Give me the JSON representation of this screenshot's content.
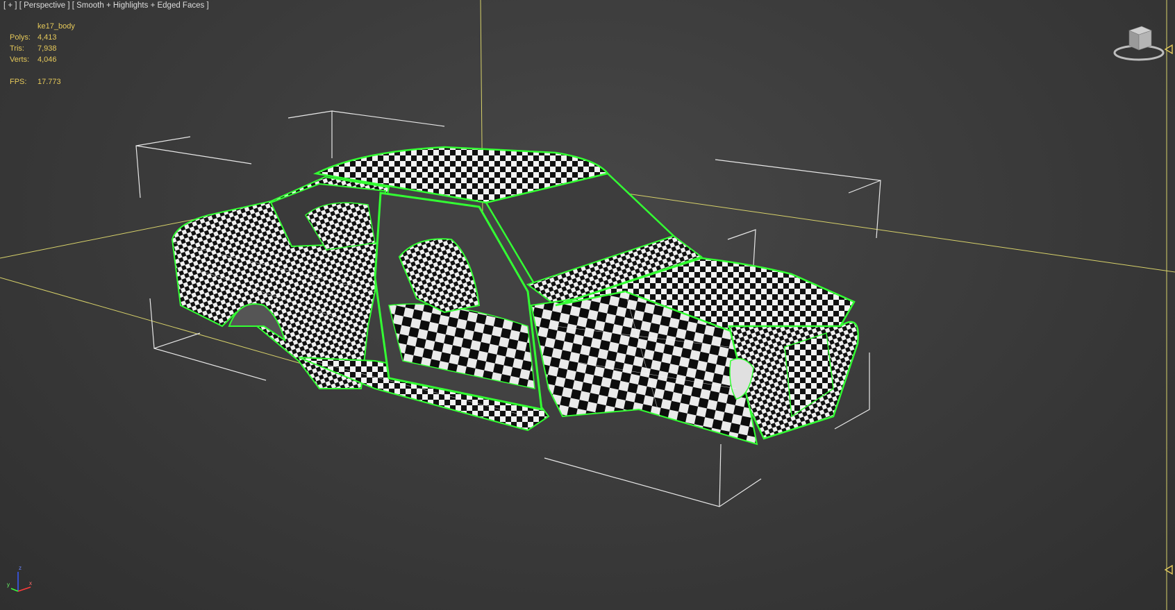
{
  "viewport": {
    "label": "[ + ] [ Perspective ] [ Smooth + Highlights + Edged Faces ]"
  },
  "stats": {
    "object_name": "ke17_body",
    "rows": [
      {
        "label": "Polys:",
        "value": "4,413"
      },
      {
        "label": "Tris:",
        "value": "7,938"
      },
      {
        "label": "Verts:",
        "value": "4,046"
      }
    ],
    "fps_label": "FPS:",
    "fps_value": "17.773"
  },
  "axis_gizmo": {
    "x": "x",
    "y": "y",
    "z": "z"
  },
  "colors": {
    "selection_edges": "#33ff33",
    "bounding_brackets": "#e8e8e8",
    "grid_lines": "#d8d26a",
    "hud_text": "#e6c95a"
  },
  "icons": {
    "viewcube": "viewcube-icon",
    "viewport_arrow": "viewport-arrow-icon"
  }
}
